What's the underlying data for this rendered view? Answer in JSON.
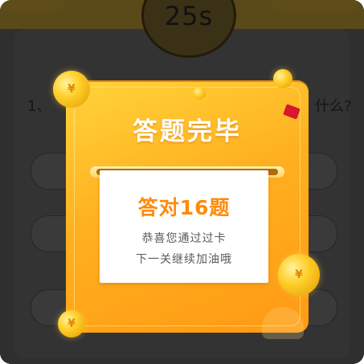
{
  "background": {
    "timer": "25s",
    "question_start": "1、",
    "question_end": "什么?"
  },
  "dialog": {
    "title": "答题完毕",
    "score": "答对16题",
    "message_line1": "恭喜您通过过卡",
    "message_line2": "下一关继续加油哦"
  },
  "colors": {
    "dialog_gradient_top": "#ffd43a",
    "dialog_gradient_bottom": "#ff9a14",
    "score_text": "#ff8a0a",
    "overlay": "#2f2f2f"
  },
  "icons": {
    "coin": "coin-icon",
    "gem": "red-gem-icon"
  }
}
